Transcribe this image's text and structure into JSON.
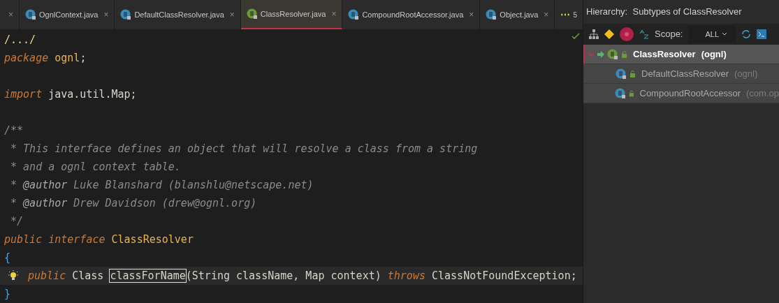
{
  "tabs": [
    {
      "kind": "none",
      "close": "×",
      "selected": false
    },
    {
      "kind": "class",
      "label": "OgnlContext.java",
      "close": "×",
      "selected": false
    },
    {
      "kind": "class",
      "label": "DefaultClassResolver.java",
      "close": "×",
      "selected": false
    },
    {
      "kind": "interface",
      "label": "ClassResolver.java",
      "close": "×",
      "selected": true
    },
    {
      "kind": "class",
      "label": "CompoundRootAccessor.java",
      "close": "×",
      "selected": false
    },
    {
      "kind": "class",
      "label": "Object.java",
      "close": "×",
      "selected": false
    }
  ],
  "tab_overflow": {
    "dots": "⋯",
    "count": "5"
  },
  "editor": {
    "lines": [
      {
        "current": false,
        "tokens": [
          {
            "kind": "folded",
            "text": "/.../"
          }
        ]
      },
      {
        "current": false,
        "tokens": [
          {
            "kind": "keyword",
            "text": "package "
          },
          {
            "kind": "name",
            "text": "ognl"
          },
          {
            "kind": "plain",
            "text": ";"
          }
        ]
      },
      {
        "current": false
      },
      {
        "current": false,
        "tokens": [
          {
            "kind": "keyword",
            "text": "import "
          },
          {
            "kind": "plain",
            "text": "java.util.Map;"
          }
        ]
      },
      {
        "current": false
      },
      {
        "current": false,
        "tokens": [
          {
            "kind": "comment",
            "text": "/**"
          }
        ]
      },
      {
        "current": false,
        "tokens": [
          {
            "kind": "comment",
            "text": " * This interface defines an object that will resolve a class from a string"
          }
        ]
      },
      {
        "current": false,
        "tokens": [
          {
            "kind": "comment",
            "text": " * and a ognl context table."
          }
        ]
      },
      {
        "current": false,
        "tokens": [
          {
            "kind": "comment",
            "text": " * "
          },
          {
            "kind": "tag",
            "text": "@author"
          },
          {
            "kind": "comment",
            "text": " Luke Blanshard (blanshlu@netscape.net)"
          }
        ]
      },
      {
        "current": false,
        "tokens": [
          {
            "kind": "comment",
            "text": " * "
          },
          {
            "kind": "tag",
            "text": "@author"
          },
          {
            "kind": "comment",
            "text": " Drew Davidson (drew@ognl.org)"
          }
        ]
      },
      {
        "current": false,
        "tokens": [
          {
            "kind": "comment",
            "text": " */"
          }
        ]
      },
      {
        "current": false,
        "tokens": [
          {
            "kind": "keyword",
            "text": "public interface "
          },
          {
            "kind": "name",
            "text": "ClassResolver"
          }
        ]
      },
      {
        "current": false,
        "tokens": [
          {
            "kind": "brace",
            "text": "{"
          }
        ]
      },
      {
        "current": true,
        "tokens": [
          {
            "kind": "keyword",
            "text": "public "
          },
          {
            "kind": "plain",
            "text": "Class "
          },
          {
            "kind": "boxed",
            "text": "classForName"
          },
          {
            "kind": "plain",
            "text": "(String className, Map context) "
          },
          {
            "kind": "keyword",
            "text": "throws "
          },
          {
            "kind": "plain",
            "text": "ClassNotFoundException;"
          }
        ]
      },
      {
        "current": false,
        "tokens": [
          {
            "kind": "brace",
            "text": "}"
          }
        ]
      }
    ]
  },
  "hierarchy": {
    "title": "Hierarchy:  Subtypes of ClassResolver",
    "scope_label": "Scope:",
    "scope_value": "ALL",
    "tree": [
      {
        "kind": "interface",
        "name": "ClassResolver",
        "package": "(ognl)",
        "expanded": true,
        "selected": true,
        "children": [
          {
            "kind": "class",
            "name": "DefaultClassResolver",
            "package": "(ognl)",
            "selected": false
          },
          {
            "kind": "class",
            "name": "CompoundRootAccessor",
            "package": "(com.op",
            "selected": false
          }
        ]
      }
    ]
  }
}
